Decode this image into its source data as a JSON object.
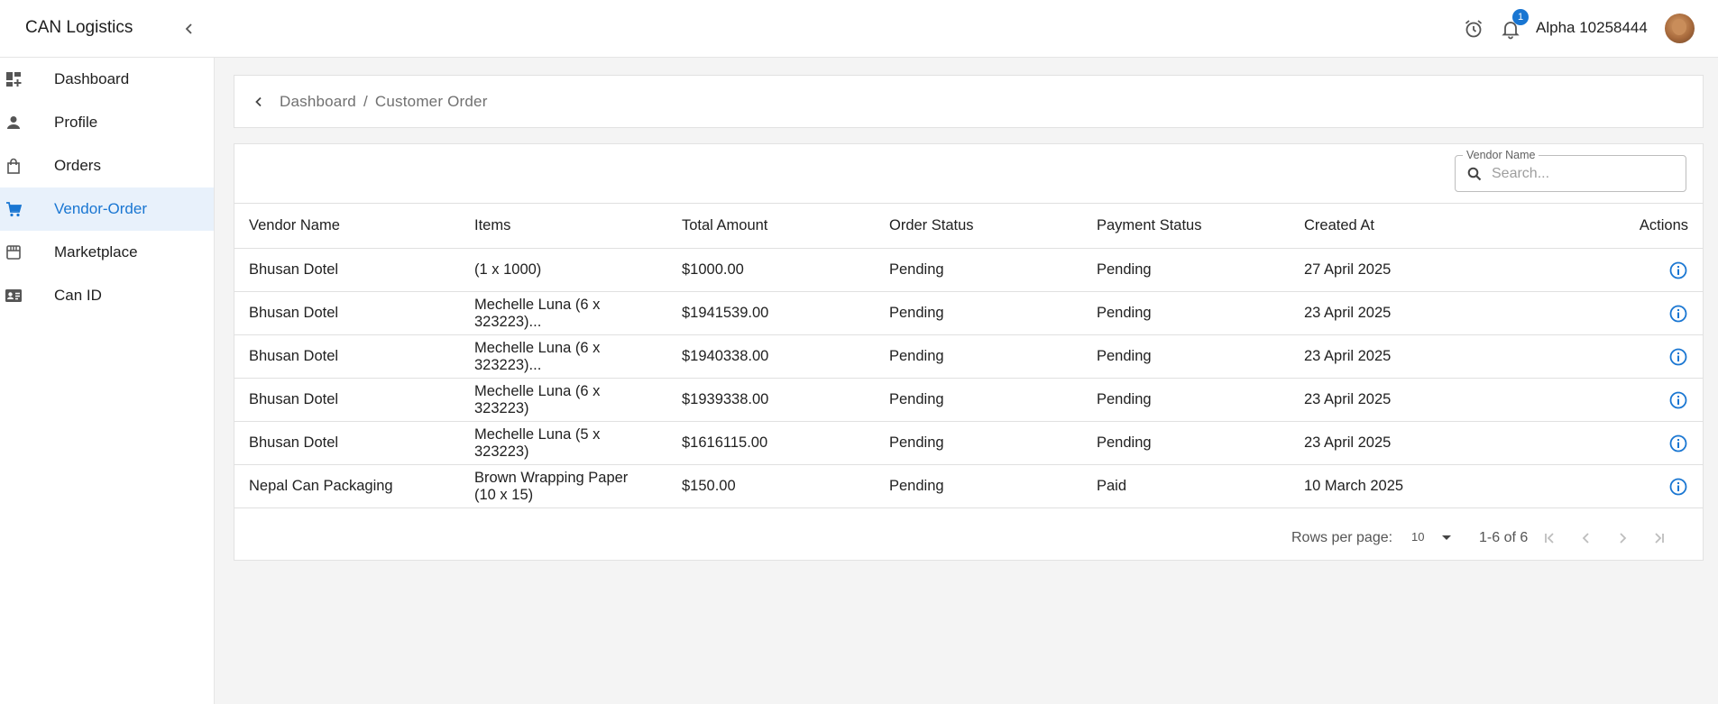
{
  "app": {
    "title": "CAN Logistics"
  },
  "header": {
    "notification_count": "1",
    "username": "Alpha 10258444"
  },
  "sidebar": {
    "items": [
      {
        "label": "Dashboard",
        "icon": "dashboard-icon"
      },
      {
        "label": "Profile",
        "icon": "person-icon"
      },
      {
        "label": "Orders",
        "icon": "shopping-bag-icon"
      },
      {
        "label": "Vendor-Order",
        "icon": "cart-icon",
        "active": true
      },
      {
        "label": "Marketplace",
        "icon": "store-icon"
      },
      {
        "label": "Can ID",
        "icon": "id-card-icon"
      }
    ]
  },
  "breadcrumb": {
    "items": [
      "Dashboard",
      "Customer Order"
    ]
  },
  "search": {
    "label": "Vendor Name",
    "placeholder": "Search...",
    "value": ""
  },
  "table": {
    "columns": [
      "Vendor Name",
      "Items",
      "Total Amount",
      "Order Status",
      "Payment Status",
      "Created At",
      "Actions"
    ],
    "rows": [
      {
        "vendor": "Bhusan Dotel",
        "items_line1": "(1 x 1000)",
        "items_line2": "",
        "total": "$1000.00",
        "order_status": "Pending",
        "payment_status": "Pending",
        "created_at": "27 April 2025"
      },
      {
        "vendor": "Bhusan Dotel",
        "items_line1": "Mechelle Luna (6 x",
        "items_line2": "323223)...",
        "total": "$1941539.00",
        "order_status": "Pending",
        "payment_status": "Pending",
        "created_at": "23 April 2025"
      },
      {
        "vendor": "Bhusan Dotel",
        "items_line1": "Mechelle Luna (6 x",
        "items_line2": "323223)...",
        "total": "$1940338.00",
        "order_status": "Pending",
        "payment_status": "Pending",
        "created_at": "23 April 2025"
      },
      {
        "vendor": "Bhusan Dotel",
        "items_line1": "Mechelle Luna (6 x",
        "items_line2": "323223)",
        "total": "$1939338.00",
        "order_status": "Pending",
        "payment_status": "Pending",
        "created_at": "23 April 2025"
      },
      {
        "vendor": "Bhusan Dotel",
        "items_line1": "Mechelle Luna (5 x",
        "items_line2": "323223)",
        "total": "$1616115.00",
        "order_status": "Pending",
        "payment_status": "Pending",
        "created_at": "23 April 2025"
      },
      {
        "vendor": "Nepal Can Packaging",
        "items_line1": "Brown Wrapping Paper",
        "items_line2": "(10 x 15)",
        "total": "$150.00",
        "order_status": "Pending",
        "payment_status": "Paid",
        "created_at": "10 March 2025"
      }
    ]
  },
  "pagination": {
    "rows_per_page_label": "Rows per page:",
    "rows_per_page": "10",
    "range": "1-6 of 6"
  },
  "colors": {
    "accent": "#1976d2",
    "active_bg": "#e8f1fb",
    "page_bg": "#f4f4f4"
  }
}
